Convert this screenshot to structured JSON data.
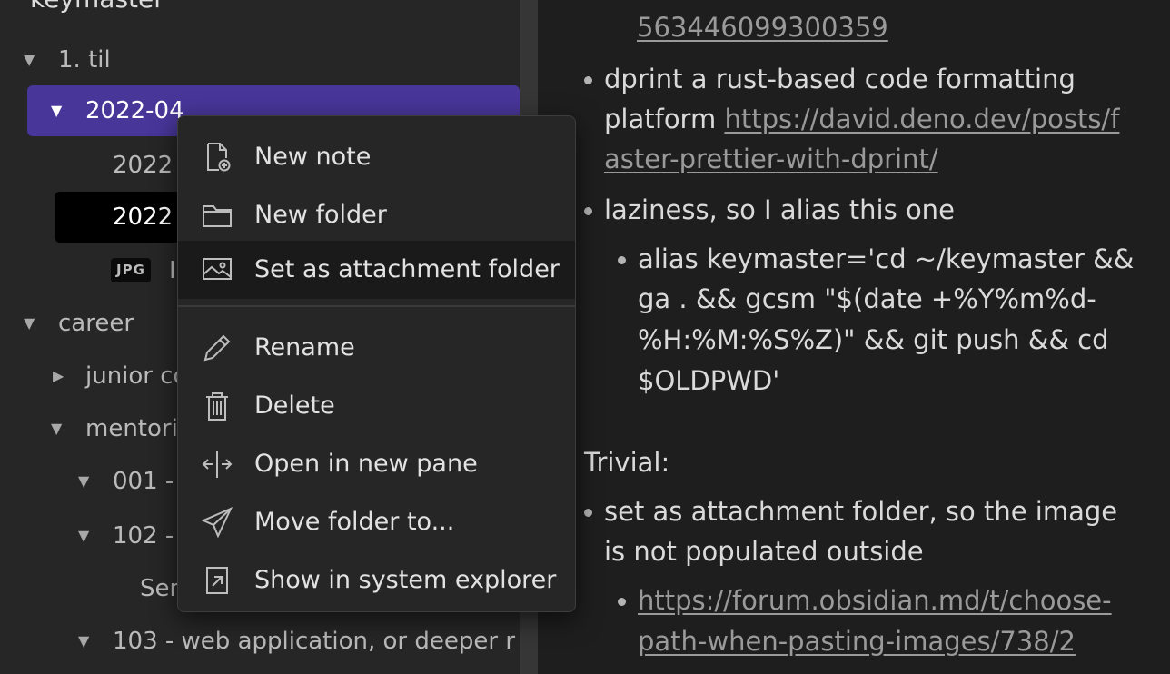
{
  "sidebar": {
    "vault_title": "keymaster",
    "items": [
      {
        "label": "1. til"
      },
      {
        "label": "2022-04"
      },
      {
        "label": "2022"
      },
      {
        "label": "2022"
      },
      {
        "badge": "JPG",
        "label": "I"
      },
      {
        "label": "career"
      },
      {
        "label": "junior co"
      },
      {
        "label": "mentori"
      },
      {
        "label": "001 -"
      },
      {
        "label": "102 -"
      },
      {
        "label": "Ser"
      },
      {
        "label": "103 - web application, or deeper r"
      }
    ]
  },
  "context_menu": {
    "items": [
      {
        "label": "New note",
        "icon": "new-note-icon"
      },
      {
        "label": "New folder",
        "icon": "folder-icon"
      },
      {
        "label": "Set as attachment folder",
        "icon": "image-icon"
      },
      {
        "label": "Rename",
        "icon": "pencil-icon"
      },
      {
        "label": "Delete",
        "icon": "trash-icon"
      },
      {
        "label": "Open in new pane",
        "icon": "split-pane-icon"
      },
      {
        "label": "Move folder to...",
        "icon": "send-icon"
      },
      {
        "label": "Show in system explorer",
        "icon": "external-link-icon"
      }
    ]
  },
  "content": {
    "top_link": "563446099300359",
    "dprint": {
      "text": "dprint a rust-based code formatting",
      "text2": "platform ",
      "link1": "https://david.deno.dev/posts/f",
      "link2": "aster-prettier-with-dprint/"
    },
    "laziness": "laziness, so I alias this one",
    "alias_lines": [
      "alias keymaster='cd ~/keymaster &&",
      "ga . && gcsm \"$(date +%Y%m%d-",
      "%H:%M:%S%Z)\" && git push && cd",
      "$OLDPWD'"
    ],
    "trivial_heading": "Trivial:",
    "attachment_lines": [
      "set as attachment folder, so the image",
      "is not populated outside"
    ],
    "forum_link": [
      "https://forum.obsidian.md/t/choose-",
      "path-when-pasting-images/738/2"
    ]
  }
}
